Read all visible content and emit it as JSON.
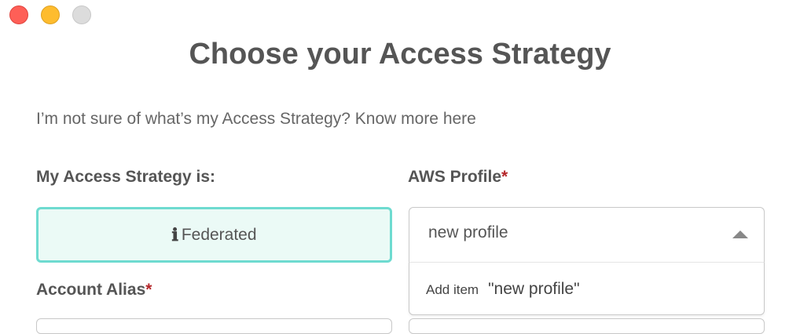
{
  "window": {
    "controls": [
      "close",
      "minimize",
      "maximize"
    ]
  },
  "page": {
    "title": "Choose your Access Strategy",
    "help_prefix": "I’m not sure of what’s my Access Strategy? ",
    "help_link": "Know more here"
  },
  "strategy": {
    "label": "My Access Strategy is:",
    "value": "Federated",
    "icon": "info-icon"
  },
  "profile": {
    "label": "AWS Profile",
    "required_mark": "*",
    "input_value": "new profile",
    "menu": {
      "prefix": "Add item",
      "value": "\"new profile\""
    }
  },
  "alias": {
    "label": "Account Alias",
    "required_mark": "*"
  },
  "colors": {
    "accent_border": "#6edbd0",
    "accent_bg": "#ebfaf6",
    "required": "#b5272b",
    "text": "#555555"
  }
}
